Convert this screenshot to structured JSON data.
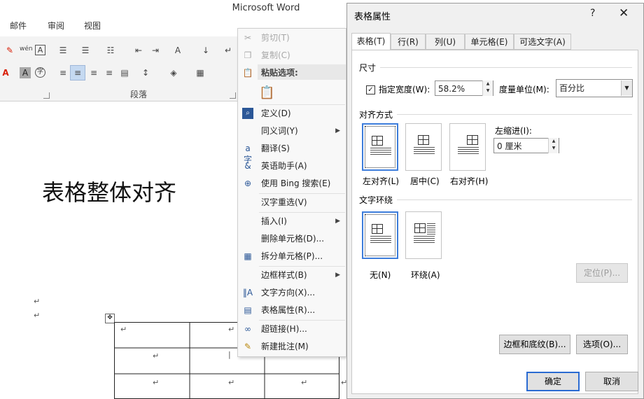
{
  "word": {
    "title": "Microsoft Word",
    "tabs": [
      "邮件",
      "审阅",
      "视图"
    ],
    "group_label": "段落",
    "document": {
      "heading": "表格整体对齐",
      "para_mark": "↵",
      "move_handle": "✥"
    }
  },
  "context_menu": {
    "items": [
      {
        "label": "剪切(T)",
        "icon": "scissors-icon",
        "disabled": true
      },
      {
        "label": "复制(C)",
        "icon": "copy-icon",
        "disabled": true
      },
      {
        "label": "粘贴选项:",
        "icon": "paste-icon",
        "disabled": false
      },
      {
        "label": "定义(D)",
        "icon": "define-icon",
        "disabled": false
      },
      {
        "label": "同义词(Y)",
        "icon": "",
        "disabled": false,
        "submenu": true
      },
      {
        "label": "翻译(S)",
        "icon": "translate-icon",
        "disabled": false
      },
      {
        "label": "英语助手(A)",
        "icon": "english-assistant-icon",
        "disabled": false
      },
      {
        "label": "使用 Bing 搜索(E)",
        "icon": "bing-search-icon",
        "disabled": false
      },
      {
        "label": "汉字重选(V)",
        "icon": "",
        "disabled": false
      },
      {
        "label": "插入(I)",
        "icon": "",
        "disabled": false,
        "submenu": true
      },
      {
        "label": "删除单元格(D)...",
        "icon": "",
        "disabled": false
      },
      {
        "label": "拆分单元格(P)...",
        "icon": "split-cells-icon",
        "disabled": false
      },
      {
        "label": "边框样式(B)",
        "icon": "",
        "disabled": false,
        "submenu": true
      },
      {
        "label": "文字方向(X)...",
        "icon": "text-direction-icon",
        "disabled": false
      },
      {
        "label": "表格属性(R)...",
        "icon": "table-properties-icon",
        "disabled": false
      },
      {
        "label": "超链接(H)...",
        "icon": "hyperlink-icon",
        "disabled": false
      },
      {
        "label": "新建批注(M)",
        "icon": "new-comment-icon",
        "disabled": false
      }
    ]
  },
  "dialog": {
    "title": "表格属性",
    "help": "?",
    "close": "✕",
    "tabs": [
      "表格(T)",
      "行(R)",
      "列(U)",
      "单元格(E)",
      "可选文字(A)"
    ],
    "active_tab": 0,
    "size_section": "尺寸",
    "preferred_width_label": "指定宽度(W):",
    "preferred_width_checked": true,
    "preferred_width_value": "58.2%",
    "measure_label": "度量单位(M):",
    "measure_value": "百分比",
    "alignment_section": "对齐方式",
    "alignment_options": [
      "左对齐(L)",
      "居中(C)",
      "右对齐(H)"
    ],
    "alignment_selected": 0,
    "indent_label": "左缩进(I):",
    "indent_value": "0 厘米",
    "wrap_section": "文字环绕",
    "wrap_options": [
      "无(N)",
      "环绕(A)"
    ],
    "wrap_selected": 0,
    "position_button": "定位(P)...",
    "borders_button": "边框和底纹(B)...",
    "options_button": "选项(O)...",
    "ok_button": "确定",
    "cancel_button": "取消"
  },
  "colors": {
    "accent": "#3d7ddb",
    "selected_button": "#c5d9f1",
    "font_color_red": "#d81e06"
  }
}
